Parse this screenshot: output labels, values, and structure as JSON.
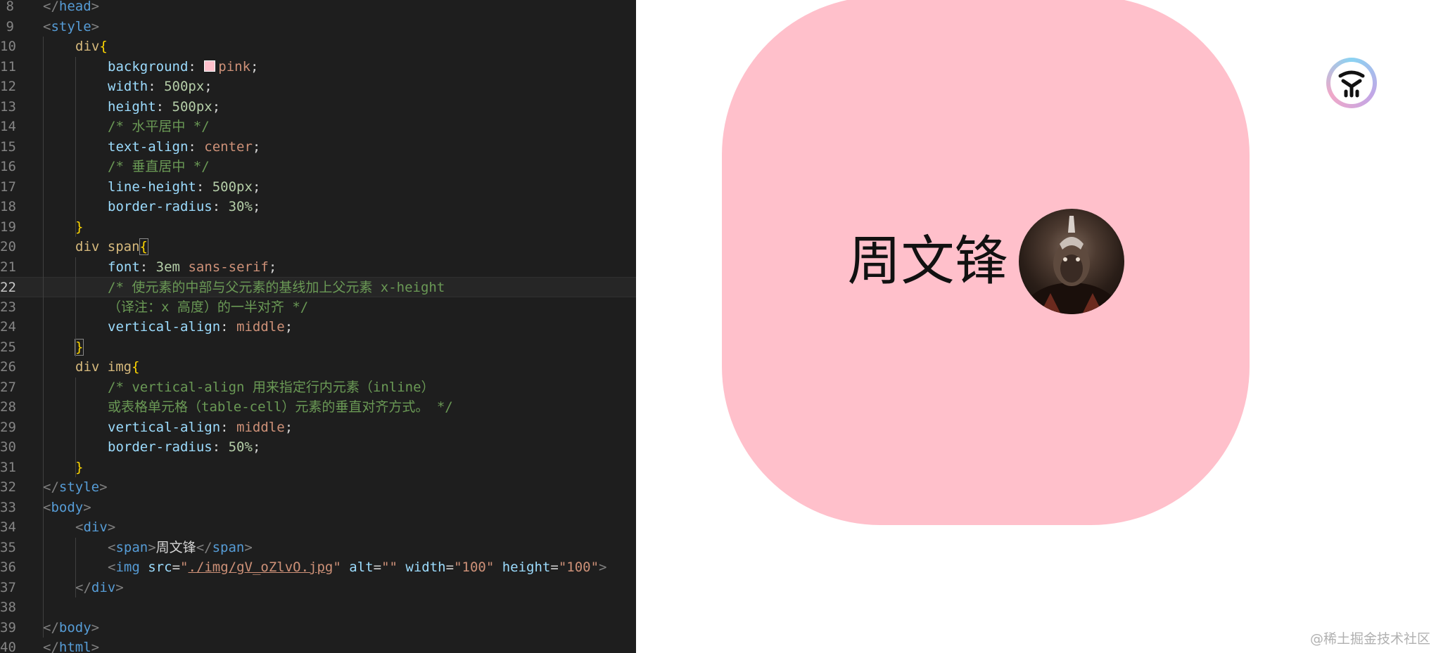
{
  "editor": {
    "lines": [
      {
        "n": "8",
        "indent": 0,
        "tokens": [
          [
            "t-punc",
            "</"
          ],
          [
            "t-tag",
            "head"
          ],
          [
            "t-punc",
            ">"
          ]
        ]
      },
      {
        "n": "9",
        "indent": 0,
        "tokens": [
          [
            "t-punc",
            "<"
          ],
          [
            "t-tag",
            "style"
          ],
          [
            "t-punc",
            ">"
          ]
        ]
      },
      {
        "n": "10",
        "indent": 1,
        "tokens": [
          [
            "t-sel",
            "div"
          ],
          [
            "t-brace",
            "{"
          ]
        ]
      },
      {
        "n": "11",
        "indent": 2,
        "tokens": [
          [
            "t-prop",
            "background"
          ],
          [
            "t-text",
            ": "
          ],
          [
            "swatch",
            ""
          ],
          [
            "t-val",
            "pink"
          ],
          [
            "t-text",
            ";"
          ]
        ]
      },
      {
        "n": "12",
        "indent": 2,
        "tokens": [
          [
            "t-prop",
            "width"
          ],
          [
            "t-text",
            ": "
          ],
          [
            "t-num",
            "500px"
          ],
          [
            "t-text",
            ";"
          ]
        ]
      },
      {
        "n": "13",
        "indent": 2,
        "tokens": [
          [
            "t-prop",
            "height"
          ],
          [
            "t-text",
            ": "
          ],
          [
            "t-num",
            "500px"
          ],
          [
            "t-text",
            ";"
          ]
        ]
      },
      {
        "n": "14",
        "indent": 2,
        "tokens": [
          [
            "t-com",
            "/* 水平居中 */"
          ]
        ]
      },
      {
        "n": "15",
        "indent": 2,
        "tokens": [
          [
            "t-prop",
            "text-align"
          ],
          [
            "t-text",
            ": "
          ],
          [
            "t-val",
            "center"
          ],
          [
            "t-text",
            ";"
          ]
        ]
      },
      {
        "n": "16",
        "indent": 2,
        "tokens": [
          [
            "t-com",
            "/* 垂直居中 */"
          ]
        ]
      },
      {
        "n": "17",
        "indent": 2,
        "tokens": [
          [
            "t-prop",
            "line-height"
          ],
          [
            "t-text",
            ": "
          ],
          [
            "t-num",
            "500px"
          ],
          [
            "t-text",
            ";"
          ]
        ]
      },
      {
        "n": "18",
        "indent": 2,
        "tokens": [
          [
            "t-prop",
            "border-radius"
          ],
          [
            "t-text",
            ": "
          ],
          [
            "t-num",
            "30%"
          ],
          [
            "t-text",
            ";"
          ]
        ]
      },
      {
        "n": "19",
        "indent": 1,
        "tokens": [
          [
            "t-brace",
            "}"
          ]
        ]
      },
      {
        "n": "20",
        "indent": 1,
        "tokens": [
          [
            "t-sel",
            "div span"
          ],
          [
            "t-brace-box",
            "{"
          ]
        ]
      },
      {
        "n": "21",
        "indent": 2,
        "tokens": [
          [
            "t-prop",
            "font"
          ],
          [
            "t-text",
            ": "
          ],
          [
            "t-num",
            "3em"
          ],
          [
            "t-text",
            " "
          ],
          [
            "t-val",
            "sans-serif"
          ],
          [
            "t-text",
            ";"
          ]
        ]
      },
      {
        "n": "22",
        "indent": 2,
        "current": true,
        "tokens": [
          [
            "t-com",
            "/* 使元素的中部与父元素的基线加上父元素 x-height"
          ]
        ]
      },
      {
        "n": "23",
        "indent": 2,
        "tokens": [
          [
            "t-com",
            "（译注：x 高度）的一半对齐 */"
          ]
        ]
      },
      {
        "n": "24",
        "indent": 2,
        "tokens": [
          [
            "t-prop",
            "vertical-align"
          ],
          [
            "t-text",
            ": "
          ],
          [
            "t-val",
            "middle"
          ],
          [
            "t-text",
            ";"
          ]
        ]
      },
      {
        "n": "25",
        "indent": 1,
        "tokens": [
          [
            "t-brace-box",
            "}"
          ]
        ]
      },
      {
        "n": "26",
        "indent": 1,
        "tokens": [
          [
            "t-sel",
            "div img"
          ],
          [
            "t-brace",
            "{"
          ]
        ]
      },
      {
        "n": "27",
        "indent": 2,
        "tokens": [
          [
            "t-com",
            "/* vertical-align 用来指定行内元素（inline）"
          ]
        ]
      },
      {
        "n": "28",
        "indent": 2,
        "tokens": [
          [
            "t-com",
            "或表格单元格（table-cell）元素的垂直对齐方式。 */"
          ]
        ]
      },
      {
        "n": "29",
        "indent": 2,
        "tokens": [
          [
            "t-prop",
            "vertical-align"
          ],
          [
            "t-text",
            ": "
          ],
          [
            "t-val",
            "middle"
          ],
          [
            "t-text",
            ";"
          ]
        ]
      },
      {
        "n": "30",
        "indent": 2,
        "tokens": [
          [
            "t-prop",
            "border-radius"
          ],
          [
            "t-text",
            ": "
          ],
          [
            "t-num",
            "50%"
          ],
          [
            "t-text",
            ";"
          ]
        ]
      },
      {
        "n": "31",
        "indent": 1,
        "tokens": [
          [
            "t-brace",
            "}"
          ]
        ]
      },
      {
        "n": "32",
        "indent": 0,
        "tokens": [
          [
            "t-punc",
            "</"
          ],
          [
            "t-tag",
            "style"
          ],
          [
            "t-punc",
            ">"
          ]
        ]
      },
      {
        "n": "33",
        "indent": 0,
        "tokens": [
          [
            "t-punc",
            "<"
          ],
          [
            "t-tag",
            "body"
          ],
          [
            "t-punc",
            ">"
          ]
        ]
      },
      {
        "n": "34",
        "indent": 1,
        "tokens": [
          [
            "t-punc",
            "<"
          ],
          [
            "t-tag",
            "div"
          ],
          [
            "t-punc",
            ">"
          ]
        ]
      },
      {
        "n": "35",
        "indent": 2,
        "tokens": [
          [
            "t-punc",
            "<"
          ],
          [
            "t-tag",
            "span"
          ],
          [
            "t-punc",
            ">"
          ],
          [
            "t-text",
            "周文锋"
          ],
          [
            "t-punc",
            "</"
          ],
          [
            "t-tag",
            "span"
          ],
          [
            "t-punc",
            ">"
          ]
        ]
      },
      {
        "n": "36",
        "indent": 2,
        "tokens": [
          [
            "t-punc",
            "<"
          ],
          [
            "t-tag",
            "img"
          ],
          [
            "t-text",
            " "
          ],
          [
            "t-attr",
            "src"
          ],
          [
            "t-text",
            "="
          ],
          [
            "t-str",
            "\""
          ],
          [
            "t-link",
            "./img/gV_oZlvO.jpg"
          ],
          [
            "t-str",
            "\""
          ],
          [
            "t-text",
            " "
          ],
          [
            "t-attr",
            "alt"
          ],
          [
            "t-text",
            "="
          ],
          [
            "t-str",
            "\"\""
          ],
          [
            "t-text",
            " "
          ],
          [
            "t-attr",
            "width"
          ],
          [
            "t-text",
            "="
          ],
          [
            "t-str",
            "\"100\""
          ],
          [
            "t-text",
            " "
          ],
          [
            "t-attr",
            "height"
          ],
          [
            "t-text",
            "="
          ],
          [
            "t-str",
            "\"100\""
          ],
          [
            "t-punc",
            ">"
          ]
        ]
      },
      {
        "n": "37",
        "indent": 1,
        "tokens": [
          [
            "t-punc",
            "</"
          ],
          [
            "t-tag",
            "div"
          ],
          [
            "t-punc",
            ">"
          ]
        ]
      },
      {
        "n": "38",
        "indent": 0,
        "tokens": []
      },
      {
        "n": "39",
        "indent": 0,
        "tokens": [
          [
            "t-punc",
            "</"
          ],
          [
            "t-tag",
            "body"
          ],
          [
            "t-punc",
            ">"
          ]
        ]
      },
      {
        "n": "40",
        "indent": 0,
        "tokens": [
          [
            "t-punc",
            "</"
          ],
          [
            "t-tag",
            "html"
          ],
          [
            "t-punc",
            ">"
          ]
        ]
      }
    ]
  },
  "preview": {
    "name_text": "周文锋",
    "avatar_icon": "avatar-image",
    "box_color": "#ffc0cb",
    "logo_icon": "logo-icon",
    "watermark": "@稀土掘金技术社区"
  }
}
